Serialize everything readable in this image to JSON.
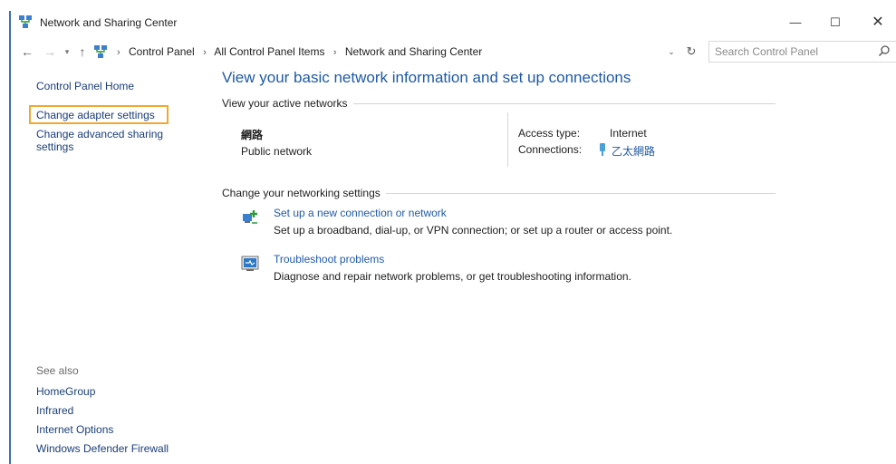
{
  "window": {
    "title": "Network and Sharing Center",
    "controls": {
      "minimize": "—",
      "maximize": "☐",
      "close": "✕"
    }
  },
  "nav": {
    "back": "←",
    "forward": "→",
    "recent": "▾",
    "up": "↑",
    "breadcrumbs": [
      "Control Panel",
      "All Control Panel Items",
      "Network and Sharing Center"
    ],
    "crumb_sep": "›",
    "dropdown": "⌄",
    "refresh": "↻",
    "search_placeholder": "Search Control Panel",
    "search_value": ""
  },
  "left_pane": {
    "home": "Control Panel Home",
    "adapter": "Change adapter settings",
    "sharing": "Change advanced sharing settings",
    "highlight_color": "#f0a830",
    "see_also_label": "See also",
    "see_also": [
      "HomeGroup",
      "Infrared",
      "Internet Options",
      "Windows Defender Firewall"
    ]
  },
  "main": {
    "title": "View your basic network information and set up connections",
    "active_networks_label": "View your active networks",
    "network": {
      "name": "網路",
      "type": "Public network",
      "access_type_label": "Access type:",
      "access_type_value": "Internet",
      "connections_label": "Connections:",
      "connections_value": "乙太網路"
    },
    "change_settings_label": "Change your networking settings",
    "tasks": [
      {
        "icon": "new-connection-icon",
        "link": "Set up a new connection or network",
        "desc": "Set up a broadband, dial-up, or VPN connection; or set up a router or access point."
      },
      {
        "icon": "troubleshoot-icon",
        "link": "Troubleshoot problems",
        "desc": "Diagnose and repair network problems, or get troubleshooting information."
      }
    ]
  },
  "colors": {
    "link": "#1f5aa6",
    "nav_link": "#1a3e78",
    "title_blue": "#1f5aa6"
  }
}
